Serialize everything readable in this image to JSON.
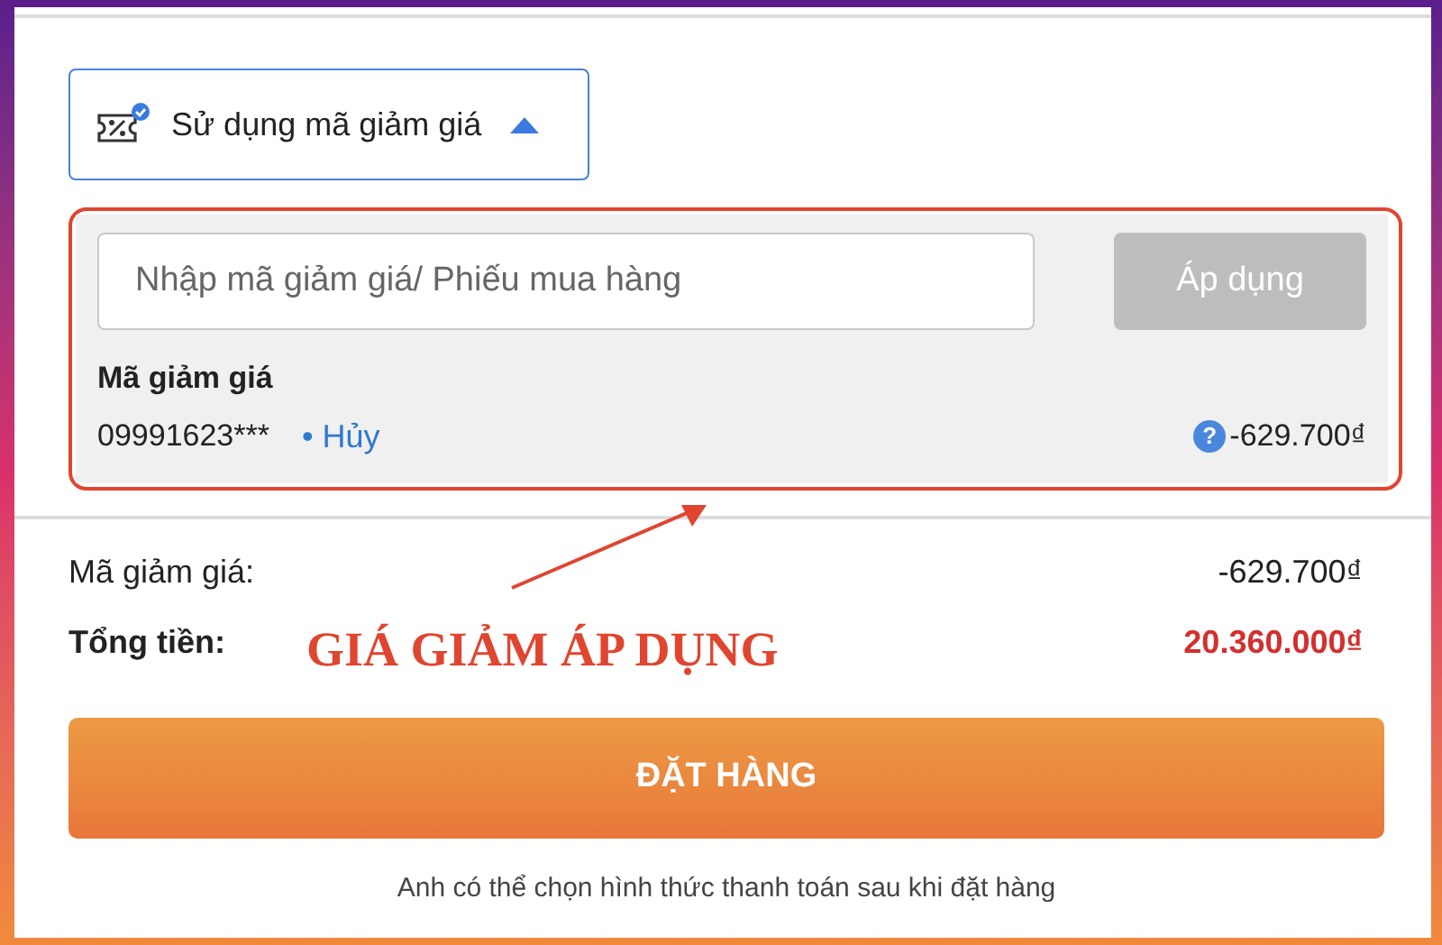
{
  "voucher_toggle": {
    "label": "Sử dụng mã giảm giá",
    "expanded": true
  },
  "voucher_panel": {
    "input": {
      "placeholder": "Nhập mã giảm giá/ Phiếu mua hàng"
    },
    "apply_button": {
      "label": "Áp dụng",
      "disabled": true
    },
    "section_title": "Mã giảm giá",
    "applied_code": {
      "code": "09991623***",
      "cancel_link": "• Hủy",
      "help_mark": "?",
      "amount": "-629.700₫"
    }
  },
  "summary": [
    {
      "label": "Mã giảm giá:",
      "value": "-629.700₫",
      "kind": "plain"
    },
    {
      "label": "Tổng tiền:",
      "value": "20.360.000₫",
      "kind": "total"
    }
  ],
  "annotation": {
    "text": "GIÁ GIẢM ÁP DỤNG"
  },
  "order_button": {
    "label": "ĐẶT HÀNG"
  },
  "footer_note": "Anh có thể chọn hình thức thanh toán sau khi đặt hàng"
}
